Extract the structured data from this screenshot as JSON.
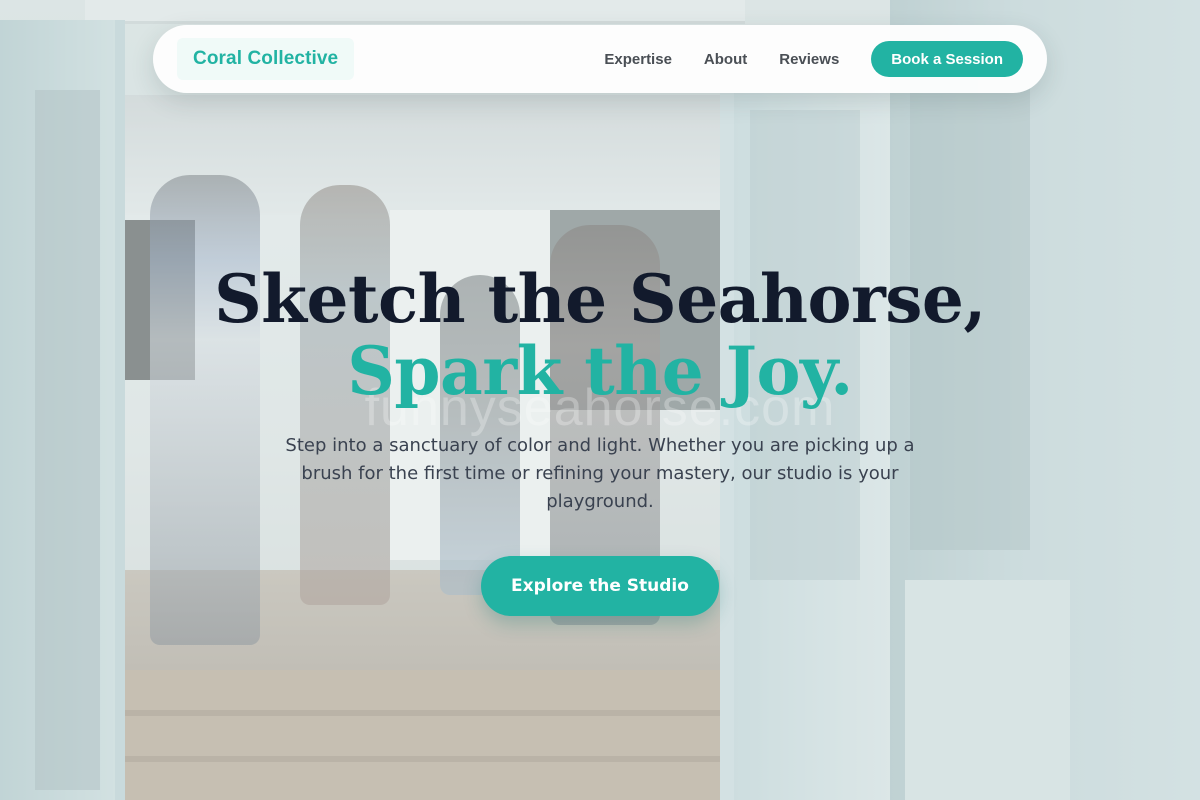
{
  "nav": {
    "brand": "Coral Collective",
    "links": [
      "Expertise",
      "About",
      "Reviews"
    ],
    "cta_label": "Book a Session"
  },
  "hero": {
    "headline": "Sketch the Seahorse,",
    "headline_accent": "Spark the Joy.",
    "subtext": "Step into a sanctuary of color and light. Whether you are picking up a brush for the first time or refining your mastery, our studio is your playground.",
    "cta_label": "Explore the Studio"
  },
  "watermark": "funnyseahorse.com",
  "colors": {
    "accent": "#22b3a3",
    "headline": "#121a2c",
    "body_text": "#3a4250",
    "nav_text": "#4a4f55"
  }
}
